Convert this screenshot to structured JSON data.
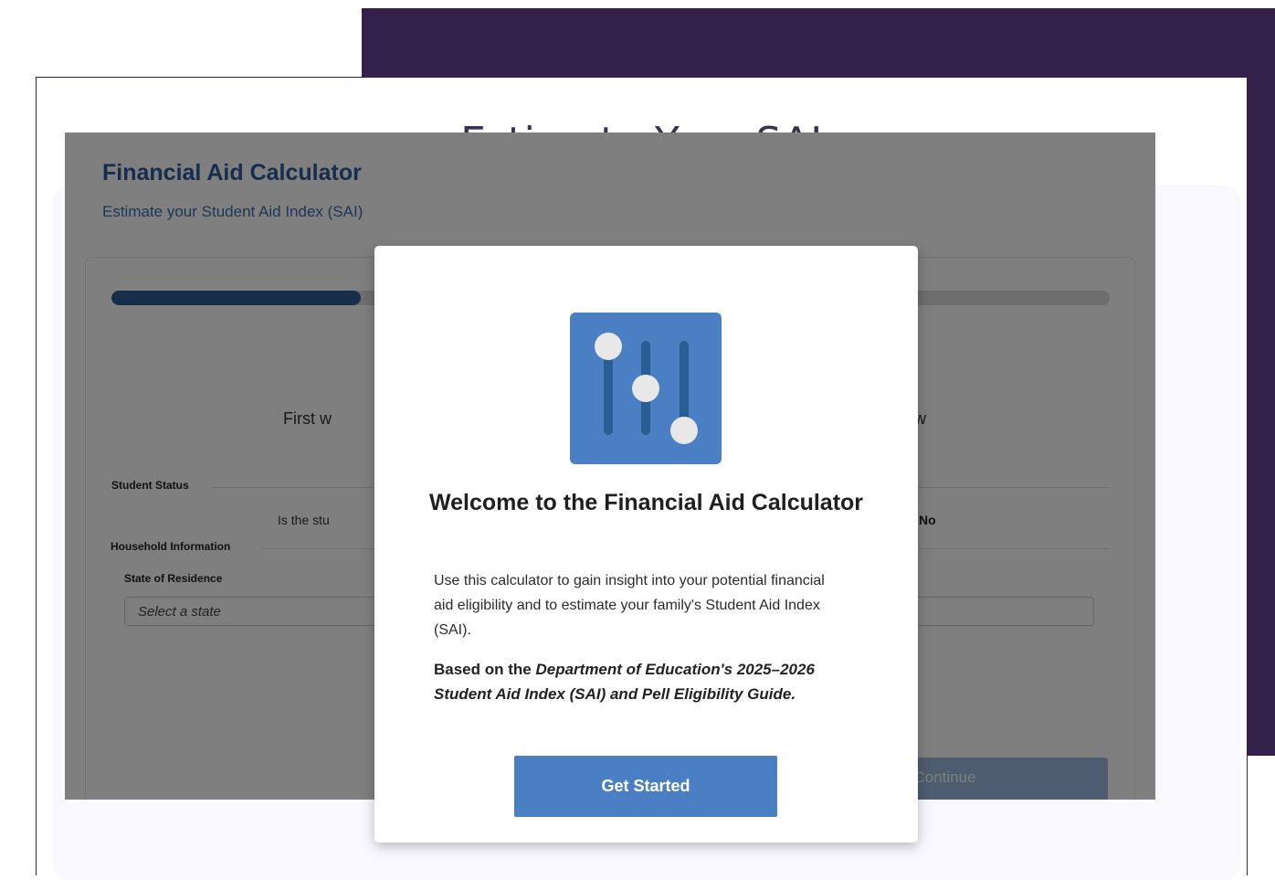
{
  "page": {
    "title": "Estimate Your SAI"
  },
  "calculator": {
    "title": "Financial Aid Calculator",
    "subtitle": "Estimate your Student Aid Index (SAI)",
    "progress_fraction": 0.25,
    "intro_left": "First w",
    "intro_right": "ne how",
    "sections": {
      "student_status": "Student Status",
      "household_information": "Household Information"
    },
    "question": "Is the stu",
    "toggle_no_label": "No",
    "state_label": "State of Residence",
    "state_placeholder": "Select a state",
    "continue_label": "Continue"
  },
  "modal": {
    "icon": "sliders-icon",
    "heading": "Welcome to the Financial Aid Calculator",
    "description": "Use this calculator to gain insight into your potential financial aid eligibility and to estimate your family's Student Aid Index (SAI).",
    "basis_prefix": "Based on the ",
    "basis_source": "Department of Education's 2025–2026 Student Aid Index (SAI) and Pell Eligibility Guide.",
    "button_label": "Get Started"
  },
  "colors": {
    "purple_backdrop": "#33204b",
    "primary_blue": "#4a7fc4",
    "heading_blue": "#2c5a9c"
  }
}
